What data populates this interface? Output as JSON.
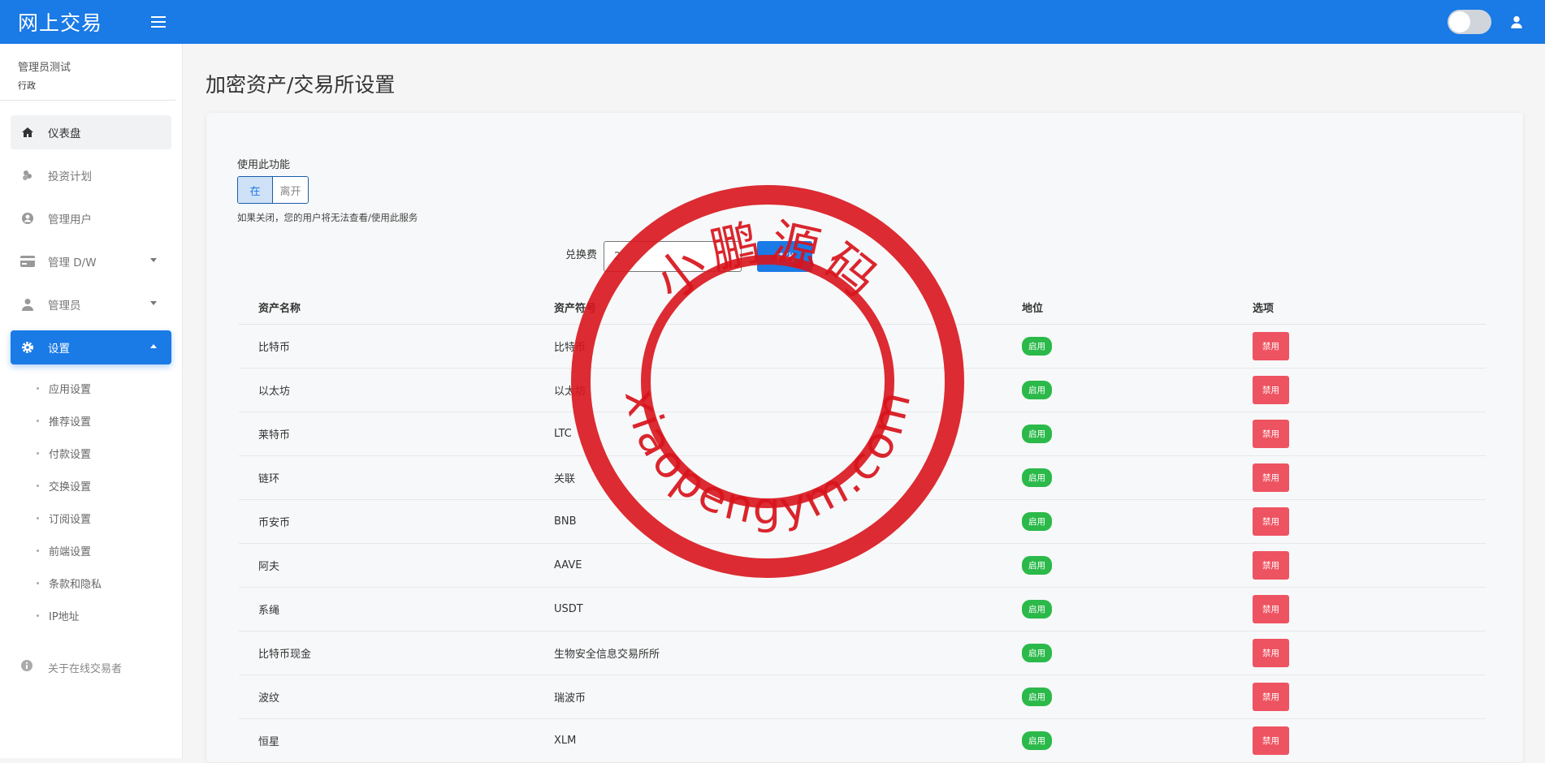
{
  "header": {
    "brand": "网上交易"
  },
  "sidebar": {
    "profile": {
      "name": "管理员测试",
      "role": "行政"
    },
    "items": [
      {
        "label": "仪表盘",
        "icon": "home-icon"
      },
      {
        "label": "投资计划",
        "icon": "coins-icon"
      },
      {
        "label": "管理用户",
        "icon": "user-circle-icon"
      },
      {
        "label": "管理 D/W",
        "icon": "credit-card-icon"
      },
      {
        "label": "管理员",
        "icon": "user-icon"
      },
      {
        "label": "设置",
        "icon": "gear-icon"
      }
    ],
    "settings_sub": [
      "应用设置",
      "推荐设置",
      "付款设置",
      "交换设置",
      "订阅设置",
      "前端设置",
      "条款和隐私",
      "IP地址"
    ],
    "about": "关于在线交易者"
  },
  "main": {
    "title": "加密资产/交易所设置",
    "feature_label": "使用此功能",
    "toggle_on": "在",
    "toggle_off": "离开",
    "hint": "如果关闭，您的用户将无法查看/使用此服务",
    "fee_label": "兑换费",
    "fee_value": "2",
    "fee_button": "节省",
    "table": {
      "headers": [
        "资产名称",
        "资产符号",
        "地位",
        "选项"
      ],
      "rows": [
        {
          "name": "比特币",
          "symbol": "比特币",
          "status": "启用",
          "action": "禁用"
        },
        {
          "name": "以太坊",
          "symbol": "以太坊",
          "status": "启用",
          "action": "禁用"
        },
        {
          "name": "莱特币",
          "symbol": "LTC",
          "status": "启用",
          "action": "禁用"
        },
        {
          "name": "链环",
          "symbol": "关联",
          "status": "启用",
          "action": "禁用"
        },
        {
          "name": "币安币",
          "symbol": "BNB",
          "status": "启用",
          "action": "禁用"
        },
        {
          "name": "阿夫",
          "symbol": "AAVE",
          "status": "启用",
          "action": "禁用"
        },
        {
          "name": "系绳",
          "symbol": "USDT",
          "status": "启用",
          "action": "禁用"
        },
        {
          "name": "比特币现金",
          "symbol": "生物安全信息交易所所",
          "status": "启用",
          "action": "禁用"
        },
        {
          "name": "波纹",
          "symbol": "瑞波币",
          "status": "启用",
          "action": "禁用"
        },
        {
          "name": "恒星",
          "symbol": "XLM",
          "status": "启用",
          "action": "禁用"
        }
      ]
    }
  },
  "watermark": {
    "top_text": "小鹏源码",
    "bottom_text": "xiaopengym.com",
    "color": "#d8141c"
  },
  "colors": {
    "primary": "#1a7ae6",
    "success": "#2bb94a",
    "danger": "#ee5361"
  }
}
